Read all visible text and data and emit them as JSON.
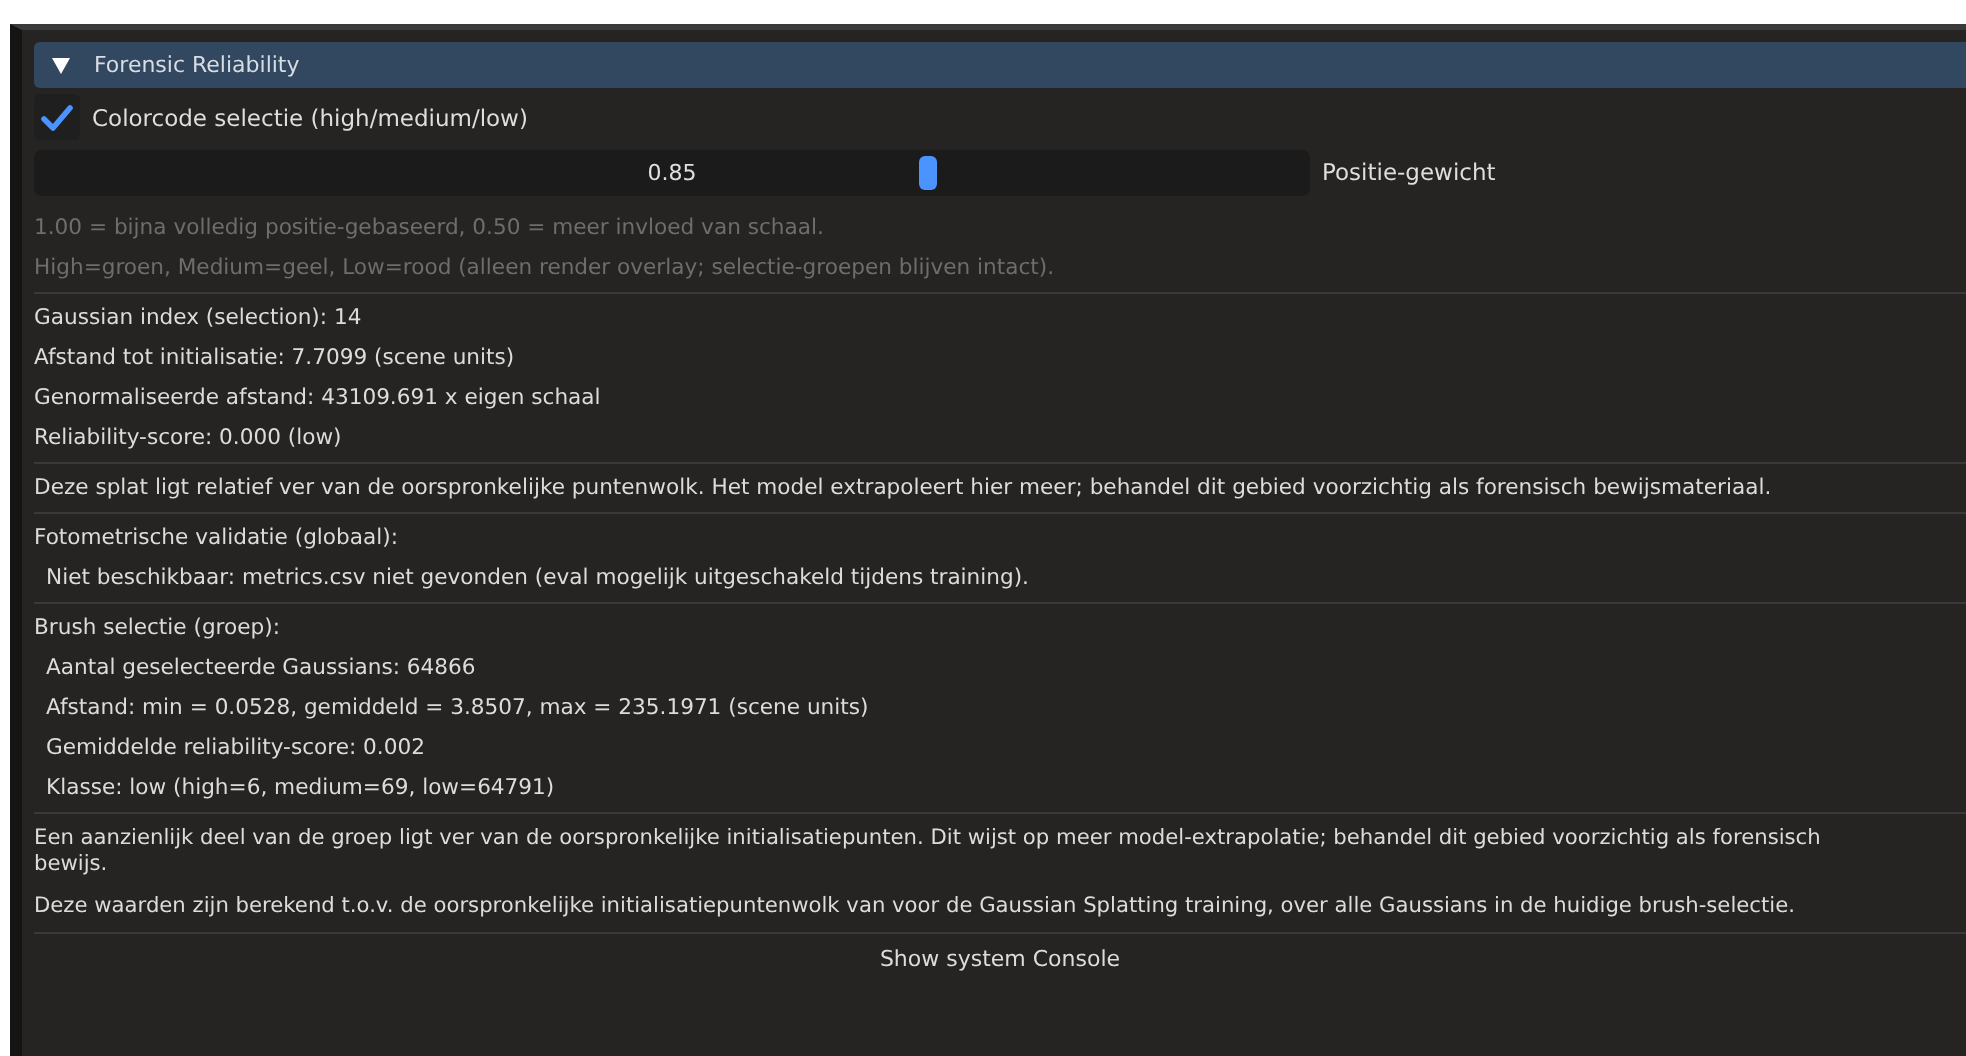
{
  "panel": {
    "title": "Forensic Reliability",
    "expanded": true
  },
  "colorcode": {
    "label": "Colorcode selectie (high/medium/low)",
    "checked": true
  },
  "slider": {
    "value": "0.85",
    "level": 0.7,
    "label": "Positie-gewicht"
  },
  "sections": [
    {
      "lines": [
        {
          "kind": "muted",
          "text": "1.00 = bijna volledig positie-gebaseerd, 0.50 = meer invloed van schaal."
        },
        {
          "kind": "muted",
          "text": "High=groen, Medium=geel, Low=rood (alleen render overlay; selectie-groepen blijven intact)."
        }
      ]
    },
    {
      "lines": [
        {
          "kind": "plain",
          "text": "Gaussian index (selection): 14"
        },
        {
          "kind": "plain",
          "text": "Afstand tot initialisatie: 7.7099 (scene units)"
        },
        {
          "kind": "plain",
          "text": "Genormaliseerde afstand: 43109.691 x eigen schaal"
        },
        {
          "kind": "plain",
          "text": "Reliability-score: 0.000 (low)"
        }
      ]
    },
    {
      "lines": [
        {
          "kind": "plain",
          "text": "Deze splat ligt relatief ver van de oorspronkelijke puntenwolk. Het model extrapoleert hier meer; behandel dit gebied voorzichtig als forensisch bewijsmateriaal."
        }
      ]
    },
    {
      "lines": [
        {
          "kind": "plain",
          "text": "Fotometrische validatie (globaal):"
        },
        {
          "kind": "indented",
          "text": "Niet beschikbaar: metrics.csv niet gevonden (eval mogelijk uitgeschakeld tijdens training)."
        }
      ]
    },
    {
      "lines": [
        {
          "kind": "plain",
          "text": "Brush selectie (groep):"
        },
        {
          "kind": "indented",
          "text": "Aantal geselecteerde Gaussians: 64866"
        },
        {
          "kind": "indented",
          "text": "Afstand: min = 0.0528, gemiddeld = 3.8507, max = 235.1971 (scene units)"
        },
        {
          "kind": "indented",
          "text": "Gemiddelde reliability-score: 0.002"
        },
        {
          "kind": "indented",
          "text": "Klasse: low (high=6, medium=69, low=64791)"
        }
      ]
    },
    {
      "lines": [
        {
          "kind": "paragraph",
          "text": "Een aanzienlijk deel van de groep ligt ver van de oorspronkelijke initialisatiepunten. Dit wijst op meer model-extrapolatie; behandel dit gebied voorzichtig als forensisch bewijs."
        },
        {
          "kind": "paragraph",
          "text": "Deze waarden zijn berekend t.o.v. de oorspronkelijke initialisatiepuntenwolk van voor de Gaussian Splatting training, over alle Gaussians in de huidige brush-selectie."
        }
      ]
    }
  ],
  "console_button": "Show system Console"
}
